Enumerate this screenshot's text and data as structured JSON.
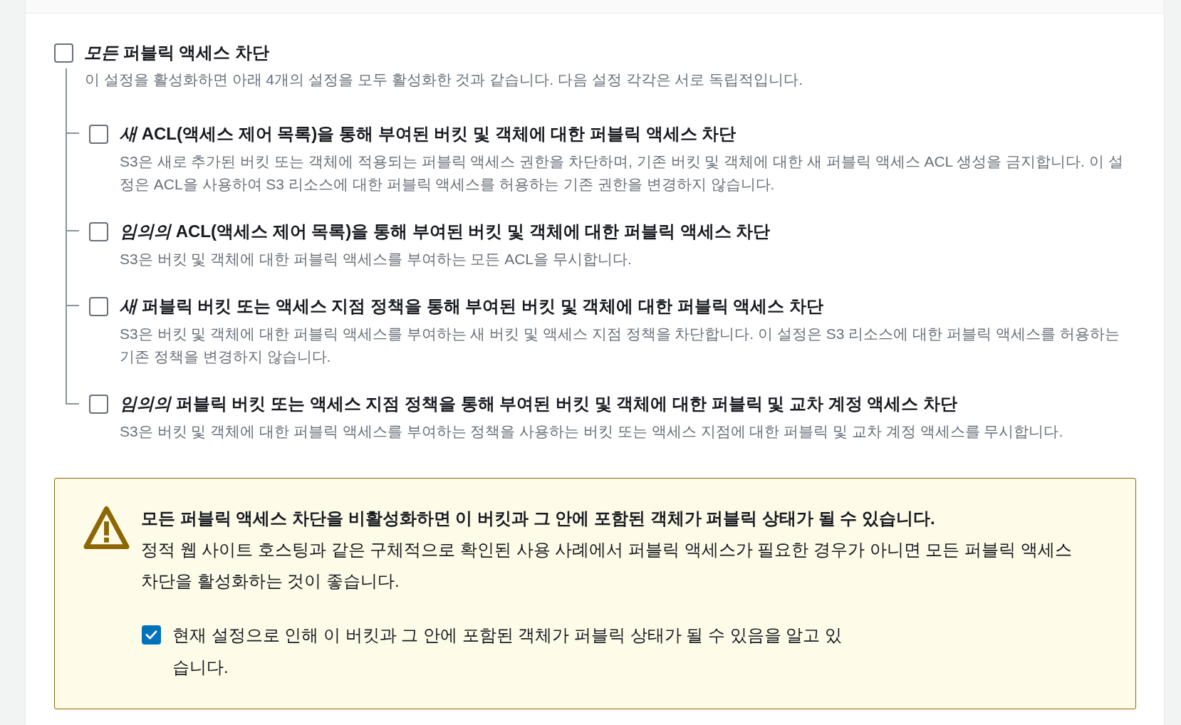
{
  "block_all": {
    "label": "*모든* 퍼블릭 액세스 차단",
    "checked": false,
    "description": "이 설정을 활성화하면 아래 4개의 설정을 모두 활성화한 것과 같습니다. 다음 설정 각각은 서로 독립적입니다."
  },
  "settings": [
    {
      "label": "*새* ACL(액세스 제어 목록)을 통해 부여된 버킷 및 객체에 대한 퍼블릭 액세스 차단",
      "checked": false,
      "description": "S3은 새로 추가된 버킷 또는 객체에 적용되는 퍼블릭 액세스 권한을 차단하며, 기존 버킷 및 객체에 대한 새 퍼블릭 액세스 ACL 생성을 금지합니다. 이 설정은 ACL을 사용하여 S3 리소스에 대한 퍼블릭 액세스를 허용하는 기존 권한을 변경하지 않습니다."
    },
    {
      "label": "*임의의* ACL(액세스 제어 목록)을 통해 부여된 버킷 및 객체에 대한 퍼블릭 액세스 차단",
      "checked": false,
      "description": "S3은 버킷 및 객체에 대한 퍼블릭 액세스를 부여하는 모든 ACL을 무시합니다."
    },
    {
      "label": "*새* 퍼블릭 버킷 또는 액세스 지점 정책을 통해 부여된 버킷 및 객체에 대한 퍼블릭 액세스 차단",
      "checked": false,
      "description": "S3은 버킷 및 객체에 대한 퍼블릭 액세스를 부여하는 새 버킷 및 액세스 지점 정책을 차단합니다. 이 설정은 S3 리소스에 대한 퍼블릭 액세스를 허용하는 기존 정책을 변경하지 않습니다."
    },
    {
      "label": "*임의의* 퍼블릭 버킷 또는 액세스 지점 정책을 통해 부여된 버킷 및 객체에 대한 퍼블릭 및 교차 계정 액세스 차단",
      "checked": false,
      "description": "S3은 버킷 및 객체에 대한 퍼블릭 액세스를 부여하는 정책을 사용하는 버킷 또는 액세스 지점에 대한 퍼블릭 및 교차 계정 액세스를 무시합니다."
    }
  ],
  "warning": {
    "title": "모든 퍼블릭 액세스 차단을 비활성화하면 이 버킷과 그 안에 포함된 객체가 퍼블릭 상태가 될 수 있습니다.",
    "body": "정적 웹 사이트 호스팅과 같은 구체적으로 확인된 사용 사례에서 퍼블릭 액세스가 필요한 경우가 아니면 모든 퍼블릭 액세스 차단을 활성화하는 것이 좋습니다.",
    "acknowledge": {
      "label": "현재 설정으로 인해 이 버킷과 그 안에 포함된 객체가 퍼블릭 상태가 될 수 있음을 알고 있습니다.",
      "checked": true
    }
  }
}
